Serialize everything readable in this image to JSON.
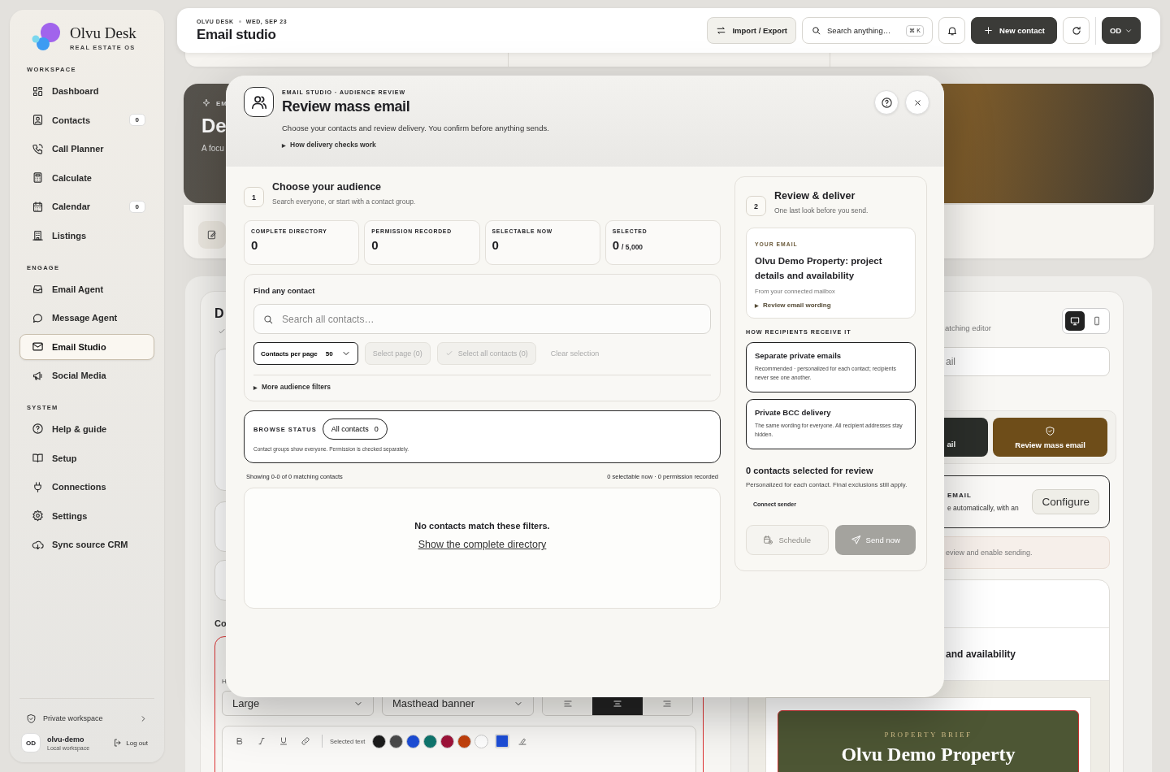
{
  "sidebar": {
    "brand": {
      "name": "Olvu Desk",
      "tagline": "REAL ESTATE OS"
    },
    "sections": [
      {
        "title": "WORKSPACE",
        "items": [
          {
            "label": "Dashboard",
            "selected": false
          },
          {
            "label": "Contacts",
            "badge": "0",
            "selected": false
          },
          {
            "label": "Call Planner",
            "selected": false
          },
          {
            "label": "Calculate",
            "selected": false
          },
          {
            "label": "Calendar",
            "badge": "0",
            "selected": false
          },
          {
            "label": "Listings",
            "selected": false
          }
        ]
      },
      {
        "title": "ENGAGE",
        "items": [
          {
            "label": "Email Agent",
            "selected": false
          },
          {
            "label": "Message Agent",
            "selected": false
          },
          {
            "label": "Email Studio",
            "selected": true
          },
          {
            "label": "Social Media",
            "selected": false
          }
        ]
      },
      {
        "title": "SYSTEM",
        "items": [
          {
            "label": "Help & guide",
            "selected": false
          },
          {
            "label": "Setup",
            "selected": false
          },
          {
            "label": "Connections",
            "selected": false
          },
          {
            "label": "Settings",
            "selected": false
          },
          {
            "label": "Sync source CRM",
            "selected": false
          }
        ]
      }
    ],
    "footer": {
      "workspace": "Private workspace",
      "user": {
        "initials": "OD",
        "name": "olvu-demo",
        "subtitle": "Local workspace"
      },
      "logout": "Log out"
    }
  },
  "topbar": {
    "eyebrow": "OLVU DESK",
    "date": "WED, SEP 23",
    "title": "Email studio",
    "import_export": "Import / Export",
    "search": {
      "placeholder": "Search anything…",
      "shortcut": "⌘ K"
    },
    "new_contact": "New contact",
    "account": "OD"
  },
  "background": {
    "hero": {
      "tag": "EM",
      "title": "De",
      "subtitle": "A focu"
    },
    "editor": {
      "heading": "D",
      "section": "Co",
      "field_label": "H",
      "size_select": "Large",
      "style_select": "Masthead banner",
      "alignment": [
        {
          "selected": false
        },
        {
          "selected": true
        },
        {
          "selected": false
        }
      ],
      "toolbar": {
        "label": "Selected text",
        "swatches": [
          {
            "color": "#1c1c1c"
          },
          {
            "color": "#4b4b4b"
          },
          {
            "color": "#1d4ed8"
          },
          {
            "color": "#0f766e"
          },
          {
            "color": "#9f1239"
          },
          {
            "color": "#c2410c"
          },
          {
            "color": "#ffffff"
          }
        ],
        "custom": {
          "color": "#1d4ed8"
        }
      }
    },
    "side": {
      "devices": [
        {
          "selected": true
        },
        {
          "selected": false
        }
      ],
      "editor_note": "atching editor",
      "subject_field": "ail",
      "dark_button": "ail",
      "review_button": "Review mass email",
      "sender": {
        "title": "EMAIL",
        "text": "e automatically, with an",
        "button": "Configure"
      },
      "notice": "eview and enable sending.",
      "preview": {
        "subject": "and availability",
        "eyebrow": "PROPERTY BRIEF",
        "title": "Olvu Demo Property"
      }
    }
  },
  "modal": {
    "eyebrow": "EMAIL STUDIO · AUDIENCE REVIEW",
    "title": "Review mass email",
    "description": "Choose your contacts and review delivery. You confirm before anything sends.",
    "details": {
      "marker": "▶",
      "label": "How delivery checks work"
    },
    "audience": {
      "step": "1",
      "title": "Choose your audience",
      "subtitle": "Search everyone, or start with a contact group.",
      "stats": [
        {
          "label": "COMPLETE DIRECTORY",
          "value": "0"
        },
        {
          "label": "PERMISSION RECORDED",
          "value": "0"
        },
        {
          "label": "SELECTABLE NOW",
          "value": "0"
        },
        {
          "label": "SELECTED",
          "value": "0",
          "suffix": "/ 5,000"
        }
      ],
      "find": {
        "title": "Find any contact",
        "placeholder": "Search all contacts…",
        "per_page": {
          "label": "Contacts per page",
          "value": "50"
        },
        "actions": [
          {
            "label": "Select page (0)",
            "disabled": true
          },
          {
            "label": "Select all contacts (0)",
            "disabled": true,
            "check": true
          },
          {
            "label": "Clear selection",
            "disabled": true,
            "plain": true
          }
        ],
        "more_filters": {
          "marker": "▶",
          "label": "More audience filters"
        }
      },
      "browse": {
        "label": "BROWSE STATUS",
        "chip": {
          "label": "All contacts",
          "count": "0"
        },
        "note": "Contact groups show everyone. Permission is checked separately."
      },
      "showing": "Showing 0-0 of 0 matching contacts",
      "summary": "0 selectable now · 0 permission recorded",
      "empty": {
        "title": "No contacts match these filters.",
        "link": "Show the complete directory"
      }
    },
    "review": {
      "step": "2",
      "title": "Review & deliver",
      "subtitle": "One last look before you send.",
      "email": {
        "label": "YOUR EMAIL",
        "subject": "Olvu Demo Property: project details and availability",
        "from": "From your connected mailbox",
        "details": {
          "marker": "▶",
          "label": "Review email wording"
        }
      },
      "delivery_title": "HOW RECIPIENTS RECEIVE IT",
      "delivery": [
        {
          "title": "Separate private emails",
          "text": "Recommended · personalized for each contact; recipients never see one another."
        },
        {
          "title": "Private BCC delivery",
          "text": "The same wording for everyone. All recipient addresses stay hidden."
        }
      ],
      "count_title": "0 contacts selected for review",
      "count_text": "Personalized for each contact. Final exclusions still apply.",
      "connect": "Connect sender",
      "schedule": {
        "label": "Schedule",
        "disabled": true
      },
      "send": {
        "label": "Send now",
        "disabled": true
      }
    }
  }
}
